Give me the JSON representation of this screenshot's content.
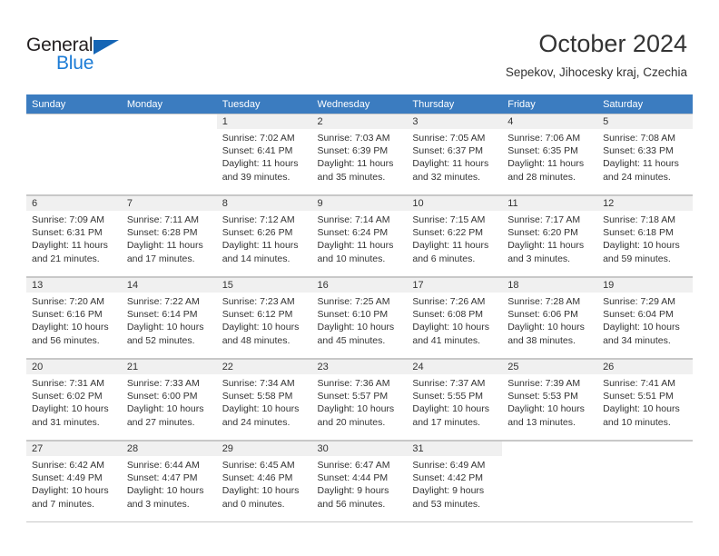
{
  "brand": {
    "name_top": "General",
    "name_bottom": "Blue",
    "color_dark": "#231f20",
    "color_blue": "#1c7cd6",
    "triangle_color": "#1565b5"
  },
  "header": {
    "title": "October 2024",
    "subtitle": "Sepekov, Jihocesky kraj, Czechia"
  },
  "theme": {
    "header_row_bg": "#3b7cc0",
    "daynum_bg": "#f0f0f0",
    "grid_line": "#c8c8c8",
    "text": "#333333"
  },
  "weekdays": [
    "Sunday",
    "Monday",
    "Tuesday",
    "Wednesday",
    "Thursday",
    "Friday",
    "Saturday"
  ],
  "labels": {
    "sunrise_prefix": "Sunrise:",
    "sunset_prefix": "Sunset:",
    "daylight_prefix": "Daylight:"
  },
  "weeks": [
    [
      {
        "day": "",
        "blank": true,
        "l1": "",
        "l2": "",
        "l3": "",
        "l4": ""
      },
      {
        "day": "",
        "blank": true,
        "l1": "",
        "l2": "",
        "l3": "",
        "l4": ""
      },
      {
        "day": "1",
        "l1": "Sunrise: 7:02 AM",
        "l2": "Sunset: 6:41 PM",
        "l3": "Daylight: 11 hours",
        "l4": "and 39 minutes."
      },
      {
        "day": "2",
        "l1": "Sunrise: 7:03 AM",
        "l2": "Sunset: 6:39 PM",
        "l3": "Daylight: 11 hours",
        "l4": "and 35 minutes."
      },
      {
        "day": "3",
        "l1": "Sunrise: 7:05 AM",
        "l2": "Sunset: 6:37 PM",
        "l3": "Daylight: 11 hours",
        "l4": "and 32 minutes."
      },
      {
        "day": "4",
        "l1": "Sunrise: 7:06 AM",
        "l2": "Sunset: 6:35 PM",
        "l3": "Daylight: 11 hours",
        "l4": "and 28 minutes."
      },
      {
        "day": "5",
        "l1": "Sunrise: 7:08 AM",
        "l2": "Sunset: 6:33 PM",
        "l3": "Daylight: 11 hours",
        "l4": "and 24 minutes."
      }
    ],
    [
      {
        "day": "6",
        "l1": "Sunrise: 7:09 AM",
        "l2": "Sunset: 6:31 PM",
        "l3": "Daylight: 11 hours",
        "l4": "and 21 minutes."
      },
      {
        "day": "7",
        "l1": "Sunrise: 7:11 AM",
        "l2": "Sunset: 6:28 PM",
        "l3": "Daylight: 11 hours",
        "l4": "and 17 minutes."
      },
      {
        "day": "8",
        "l1": "Sunrise: 7:12 AM",
        "l2": "Sunset: 6:26 PM",
        "l3": "Daylight: 11 hours",
        "l4": "and 14 minutes."
      },
      {
        "day": "9",
        "l1": "Sunrise: 7:14 AM",
        "l2": "Sunset: 6:24 PM",
        "l3": "Daylight: 11 hours",
        "l4": "and 10 minutes."
      },
      {
        "day": "10",
        "l1": "Sunrise: 7:15 AM",
        "l2": "Sunset: 6:22 PM",
        "l3": "Daylight: 11 hours",
        "l4": "and 6 minutes."
      },
      {
        "day": "11",
        "l1": "Sunrise: 7:17 AM",
        "l2": "Sunset: 6:20 PM",
        "l3": "Daylight: 11 hours",
        "l4": "and 3 minutes."
      },
      {
        "day": "12",
        "l1": "Sunrise: 7:18 AM",
        "l2": "Sunset: 6:18 PM",
        "l3": "Daylight: 10 hours",
        "l4": "and 59 minutes."
      }
    ],
    [
      {
        "day": "13",
        "l1": "Sunrise: 7:20 AM",
        "l2": "Sunset: 6:16 PM",
        "l3": "Daylight: 10 hours",
        "l4": "and 56 minutes."
      },
      {
        "day": "14",
        "l1": "Sunrise: 7:22 AM",
        "l2": "Sunset: 6:14 PM",
        "l3": "Daylight: 10 hours",
        "l4": "and 52 minutes."
      },
      {
        "day": "15",
        "l1": "Sunrise: 7:23 AM",
        "l2": "Sunset: 6:12 PM",
        "l3": "Daylight: 10 hours",
        "l4": "and 48 minutes."
      },
      {
        "day": "16",
        "l1": "Sunrise: 7:25 AM",
        "l2": "Sunset: 6:10 PM",
        "l3": "Daylight: 10 hours",
        "l4": "and 45 minutes."
      },
      {
        "day": "17",
        "l1": "Sunrise: 7:26 AM",
        "l2": "Sunset: 6:08 PM",
        "l3": "Daylight: 10 hours",
        "l4": "and 41 minutes."
      },
      {
        "day": "18",
        "l1": "Sunrise: 7:28 AM",
        "l2": "Sunset: 6:06 PM",
        "l3": "Daylight: 10 hours",
        "l4": "and 38 minutes."
      },
      {
        "day": "19",
        "l1": "Sunrise: 7:29 AM",
        "l2": "Sunset: 6:04 PM",
        "l3": "Daylight: 10 hours",
        "l4": "and 34 minutes."
      }
    ],
    [
      {
        "day": "20",
        "l1": "Sunrise: 7:31 AM",
        "l2": "Sunset: 6:02 PM",
        "l3": "Daylight: 10 hours",
        "l4": "and 31 minutes."
      },
      {
        "day": "21",
        "l1": "Sunrise: 7:33 AM",
        "l2": "Sunset: 6:00 PM",
        "l3": "Daylight: 10 hours",
        "l4": "and 27 minutes."
      },
      {
        "day": "22",
        "l1": "Sunrise: 7:34 AM",
        "l2": "Sunset: 5:58 PM",
        "l3": "Daylight: 10 hours",
        "l4": "and 24 minutes."
      },
      {
        "day": "23",
        "l1": "Sunrise: 7:36 AM",
        "l2": "Sunset: 5:57 PM",
        "l3": "Daylight: 10 hours",
        "l4": "and 20 minutes."
      },
      {
        "day": "24",
        "l1": "Sunrise: 7:37 AM",
        "l2": "Sunset: 5:55 PM",
        "l3": "Daylight: 10 hours",
        "l4": "and 17 minutes."
      },
      {
        "day": "25",
        "l1": "Sunrise: 7:39 AM",
        "l2": "Sunset: 5:53 PM",
        "l3": "Daylight: 10 hours",
        "l4": "and 13 minutes."
      },
      {
        "day": "26",
        "l1": "Sunrise: 7:41 AM",
        "l2": "Sunset: 5:51 PM",
        "l3": "Daylight: 10 hours",
        "l4": "and 10 minutes."
      }
    ],
    [
      {
        "day": "27",
        "l1": "Sunrise: 6:42 AM",
        "l2": "Sunset: 4:49 PM",
        "l3": "Daylight: 10 hours",
        "l4": "and 7 minutes."
      },
      {
        "day": "28",
        "l1": "Sunrise: 6:44 AM",
        "l2": "Sunset: 4:47 PM",
        "l3": "Daylight: 10 hours",
        "l4": "and 3 minutes."
      },
      {
        "day": "29",
        "l1": "Sunrise: 6:45 AM",
        "l2": "Sunset: 4:46 PM",
        "l3": "Daylight: 10 hours",
        "l4": "and 0 minutes."
      },
      {
        "day": "30",
        "l1": "Sunrise: 6:47 AM",
        "l2": "Sunset: 4:44 PM",
        "l3": "Daylight: 9 hours",
        "l4": "and 56 minutes."
      },
      {
        "day": "31",
        "l1": "Sunrise: 6:49 AM",
        "l2": "Sunset: 4:42 PM",
        "l3": "Daylight: 9 hours",
        "l4": "and 53 minutes."
      },
      {
        "day": "",
        "blank": true,
        "l1": "",
        "l2": "",
        "l3": "",
        "l4": ""
      },
      {
        "day": "",
        "blank": true,
        "l1": "",
        "l2": "",
        "l3": "",
        "l4": ""
      }
    ]
  ]
}
